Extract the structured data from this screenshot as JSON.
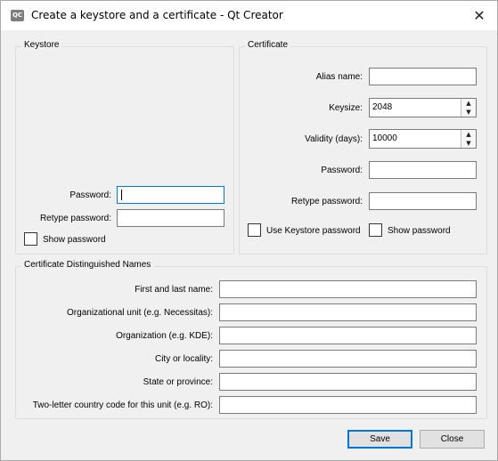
{
  "window": {
    "title": "Create a keystore and a certificate - Qt Creator",
    "app_icon_text": "QC",
    "close_glyph": "✕"
  },
  "keystore": {
    "group_title": "Keystore",
    "password_label": "Password:",
    "password_value": "",
    "retype_label": "Retype password:",
    "retype_value": "",
    "show_password_label": "Show password",
    "show_password_checked": false
  },
  "certificate": {
    "group_title": "Certificate",
    "alias_label": "Alias name:",
    "alias_value": "",
    "keysize_label": "Keysize:",
    "keysize_value": "2048",
    "validity_label": "Validity (days):",
    "validity_value": "10000",
    "password_label": "Password:",
    "password_value": "",
    "retype_label": "Retype password:",
    "retype_value": "",
    "use_keystore_label": "Use Keystore password",
    "use_keystore_checked": false,
    "show_password_label": "Show password",
    "show_password_checked": false
  },
  "dn": {
    "group_title": "Certificate Distinguished Names",
    "fields": [
      {
        "label": "First and last name:",
        "value": ""
      },
      {
        "label": "Organizational unit (e.g. Necessitas):",
        "value": ""
      },
      {
        "label": "Organization (e.g. KDE):",
        "value": ""
      },
      {
        "label": "City or locality:",
        "value": ""
      },
      {
        "label": "State or province:",
        "value": ""
      },
      {
        "label": "Two-letter country code for this unit (e.g. RO):",
        "value": ""
      }
    ]
  },
  "buttons": {
    "save": "Save",
    "close": "Close"
  },
  "icons": {
    "spin_up": "▲",
    "spin_down": "▼"
  }
}
